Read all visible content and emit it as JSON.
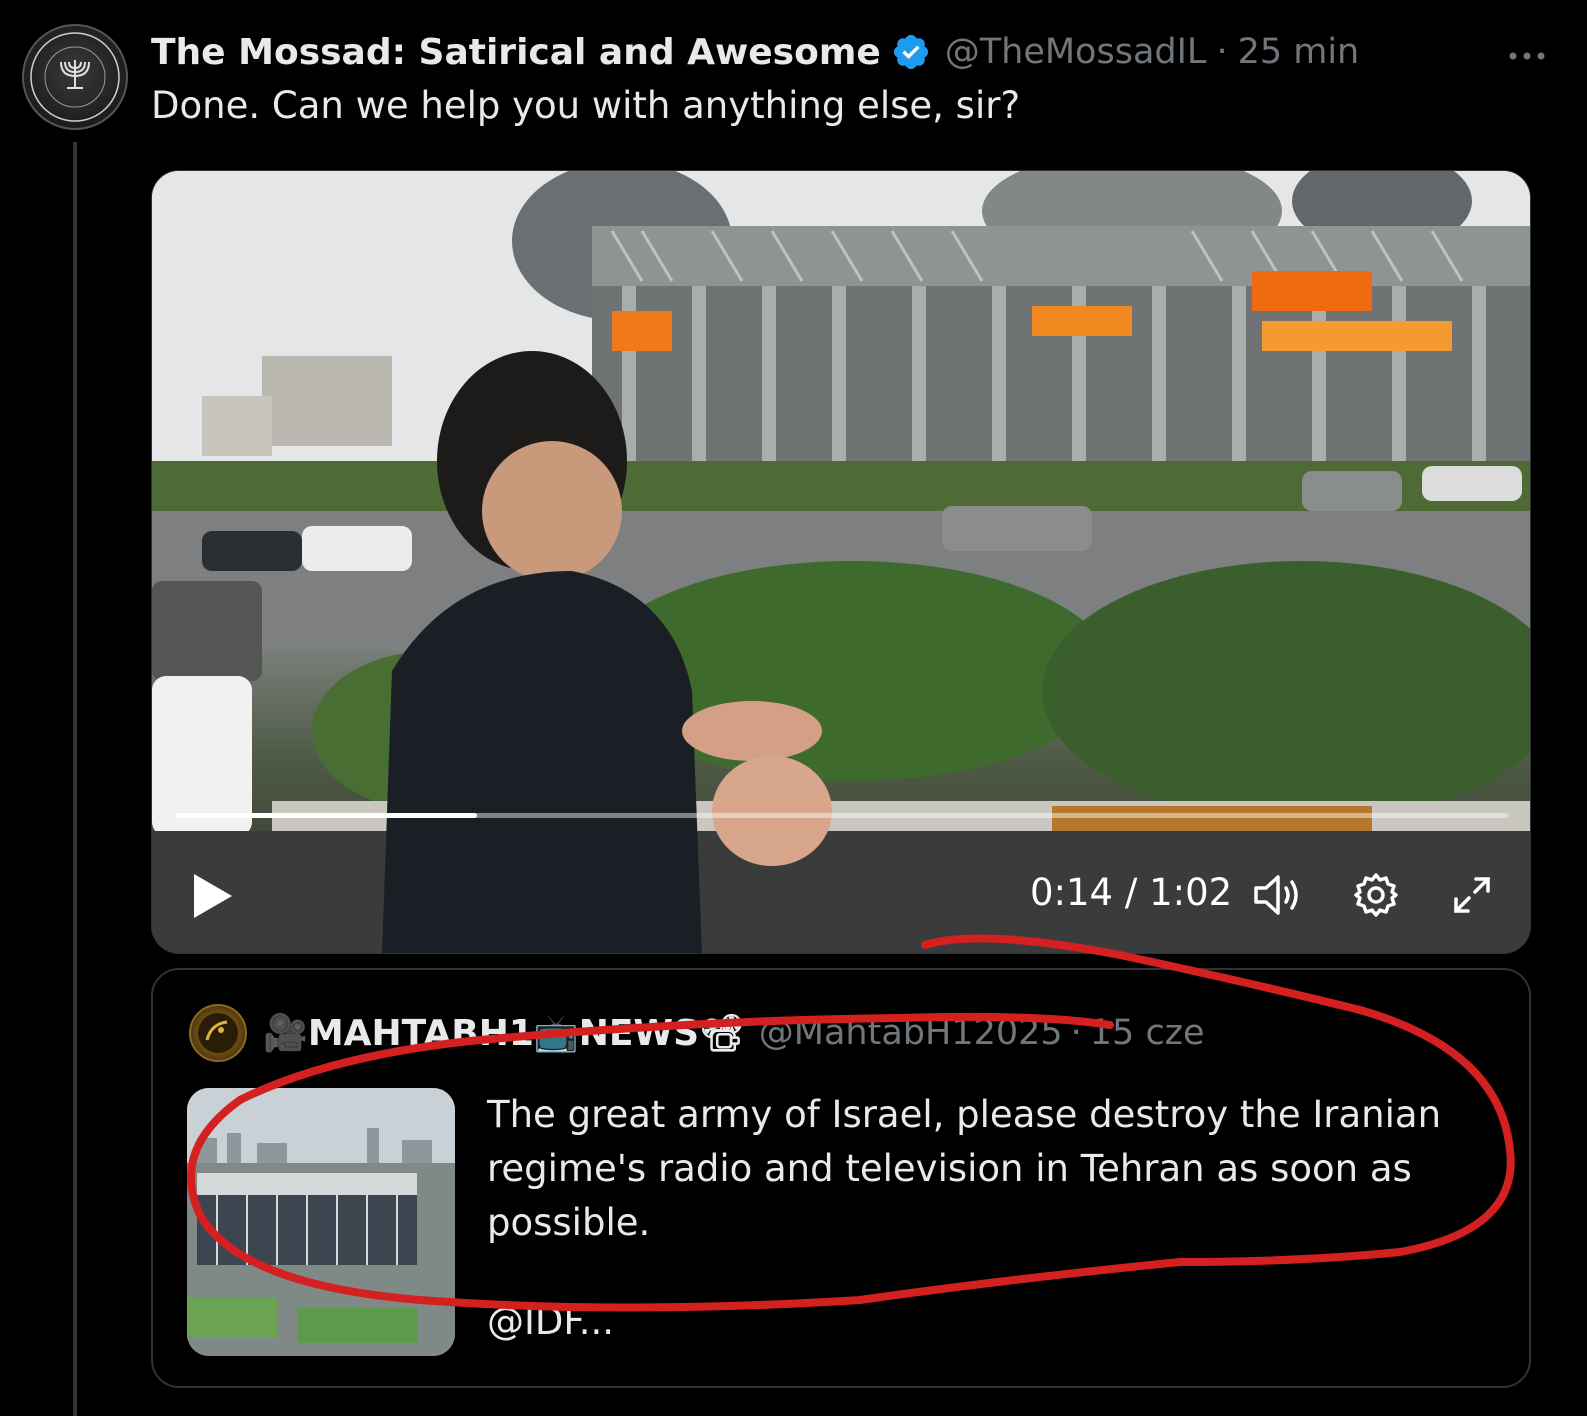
{
  "tweet": {
    "display_name": "The Mossad: Satirical and Awesome",
    "handle": "@TheMossadIL",
    "separator": "·",
    "time": "25 min",
    "text": "Done. Can we help you with anything else, sir?",
    "more_icon": "more-icon",
    "verified_icon": "verified-badge-icon"
  },
  "video": {
    "current_time": "0:14",
    "time_divider": "/",
    "duration": "1:02",
    "progress": 0.226,
    "icons": [
      "play-icon",
      "volume-icon",
      "settings-icon",
      "fullscreen-icon"
    ]
  },
  "quote": {
    "display_name": "🎥MAHTABH1📺NEWS📽",
    "handle": "@MahtabH12025",
    "separator": "·",
    "time": "15 cze",
    "text": "The great army of Israel, please destroy the Iranian regime's radio and television in Tehran as soon as possible.",
    "mention": "@IDF..."
  },
  "colors": {
    "background": "#000000",
    "text_primary": "#e7e9ea",
    "text_secondary": "#71767b",
    "border": "#2f3336",
    "verified": "#1d9bf0",
    "annotation": "#d42020"
  }
}
